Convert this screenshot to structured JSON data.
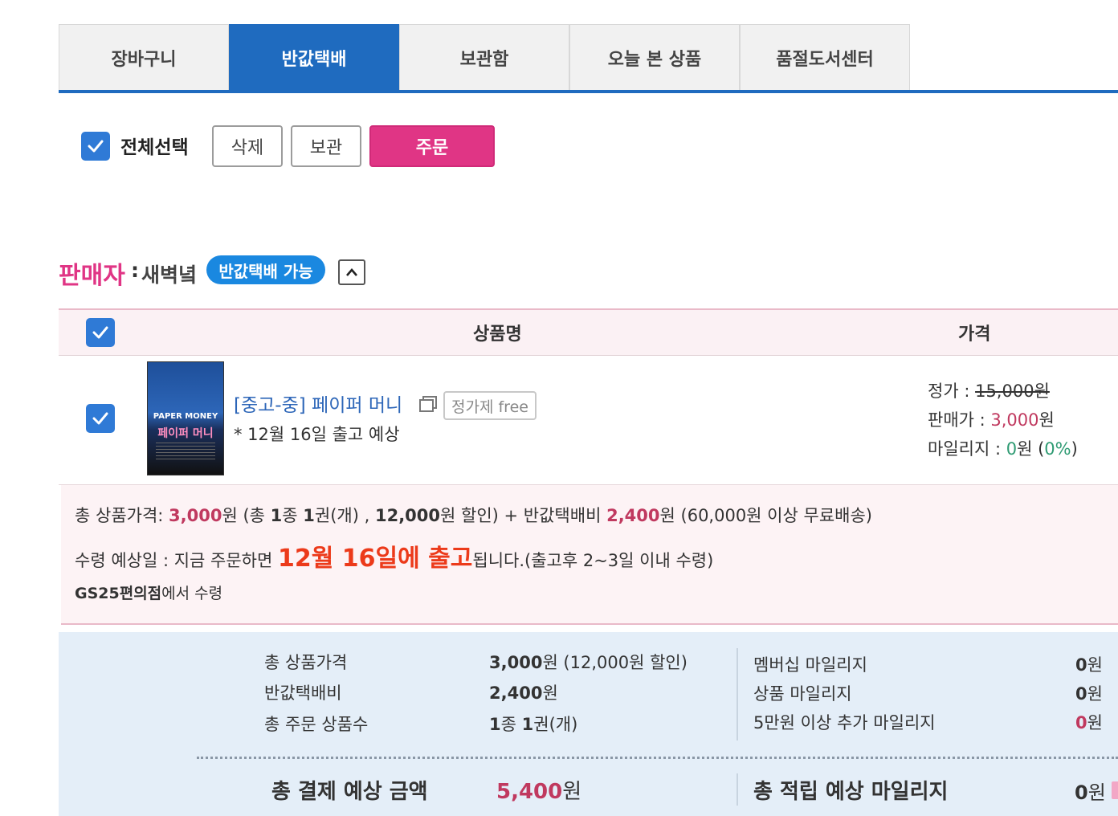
{
  "tabs": [
    {
      "label": "장바구니"
    },
    {
      "label": "반값택배"
    },
    {
      "label": "보관함"
    },
    {
      "label": "오늘 본 상품"
    },
    {
      "label": "품절도서센터"
    }
  ],
  "toolbar": {
    "select_all_label": "전체선택",
    "delete_label": "삭제",
    "keep_label": "보관",
    "order_label": "주문"
  },
  "seller": {
    "title": "판매자",
    "colon": ":",
    "name": "새벽녘",
    "badge": "반값택배 가능"
  },
  "table": {
    "col_product": "상품명",
    "col_price": "가격"
  },
  "product": {
    "title": "[중고-중] 페이퍼 머니",
    "tag": "정가제 free",
    "ship_note": "* 12월 16일 출고 예상",
    "cover_en": "PAPER MONEY",
    "cover_ko": "페이퍼 머니",
    "list_price_label": "정가 : ",
    "list_price": "15,000원",
    "sale_price_label": "판매가 : ",
    "sale_price_num": "3,000",
    "sale_price_unit": "원",
    "mileage_label": "마일리지 : ",
    "mileage_num": "0",
    "mileage_unit": "원 (",
    "mileage_pct": "0%",
    "mileage_close": ")"
  },
  "summary": {
    "l1_a": "총 상품가격: ",
    "l1_price": "3,000",
    "l1_b": "원 (총 ",
    "l1_kinds": "1",
    "l1_c": "종 ",
    "l1_qty": "1",
    "l1_d": "권(개) , ",
    "l1_disc": "12,000",
    "l1_e": "원 할인) + 반값택배비 ",
    "l1_fee": "2,400",
    "l1_f": "원 (60,000원 이상 무료배송)",
    "l2_a": "수령 예상일 : 지금 주문하면 ",
    "l2_big": "12월 16일에 출고",
    "l2_b": "됩니다.(출고후 2~3일 이내 수령)",
    "l3_bold": "GS25편의점",
    "l3_rest": "에서 수령"
  },
  "totals": {
    "rows": [
      {
        "label": "총 상품가격",
        "value_bold": "3,000",
        "value_rest": "원 (12,000원 할인)"
      },
      {
        "label": "반값택배비",
        "value_bold": "2,400",
        "value_rest": "원"
      },
      {
        "label": "총 주문 상품수",
        "value_bold": "1",
        "value_rest": "종 ",
        "value_bold2": "1",
        "value_rest2": "권(개)"
      }
    ],
    "mileage_rows": [
      {
        "label": "멤버십 마일리지",
        "value_bold": "0",
        "value_rest": "원"
      },
      {
        "label": "상품 마일리지",
        "value_bold": "0",
        "value_rest": "원"
      },
      {
        "label": "5만원 이상 추가 마일리지",
        "value_bold": "0",
        "value_rest": "원"
      }
    ],
    "grand_label": "총 결제 예상 금액",
    "grand_num": "5,400",
    "grand_unit": "원",
    "mile_label": "총 적립 예상 마일리지",
    "mile_num": "0",
    "mile_unit": "원"
  },
  "colors": {
    "accent_blue": "#1f6bbf",
    "order_pink": "#e03585",
    "highlight_red": "#ec3a1a"
  }
}
